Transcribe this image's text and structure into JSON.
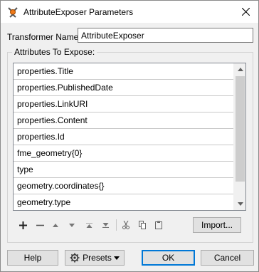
{
  "window": {
    "title": "AttributeExposer Parameters",
    "app_icon": "fme-transformer-icon",
    "close_icon": "close-icon"
  },
  "transformer_name": {
    "label": "Transformer Name:",
    "value": "AttributeExposer"
  },
  "attributes_group": {
    "legend": "Attributes To Expose:",
    "items": [
      "properties.Title",
      "properties.PublishedDate",
      "properties.LinkURI",
      "properties.Content",
      "properties.Id",
      "fme_geometry{0}",
      "type",
      "geometry.coordinates{}",
      "geometry.type"
    ]
  },
  "toolbar": {
    "icons": [
      "add-icon",
      "remove-icon",
      "move-up-icon",
      "move-down-icon",
      "move-to-top-icon",
      "move-to-bottom-icon",
      "cut-icon",
      "copy-icon",
      "paste-icon"
    ],
    "import_label": "Import..."
  },
  "footer": {
    "help_label": "Help",
    "presets_label": "Presets",
    "ok_label": "OK",
    "cancel_label": "Cancel"
  },
  "colors": {
    "dialog_bg": "#f0f0f0",
    "default_button_border": "#0078d7",
    "button_bg": "#e1e1e1"
  }
}
